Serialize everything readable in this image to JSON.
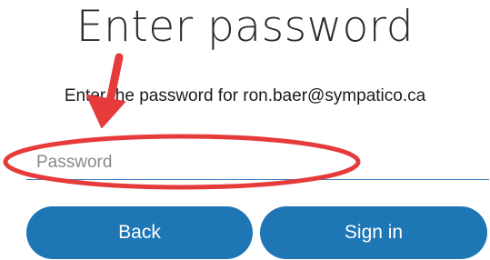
{
  "page": {
    "title": "Enter password",
    "prompt_prefix": "Enter the password for",
    "account_email": "ron.baer@sympatico.ca"
  },
  "password": {
    "placeholder": "Password",
    "value": ""
  },
  "buttons": {
    "back_label": "Back",
    "signin_label": "Sign in"
  },
  "colors": {
    "button_bg": "#1e76b4",
    "annotation": "#e63b3b",
    "field_underline": "#3a7bbf"
  },
  "annotation": {
    "arrow_icon": "red-arrow-icon",
    "highlight_icon": "red-ellipse-icon"
  }
}
